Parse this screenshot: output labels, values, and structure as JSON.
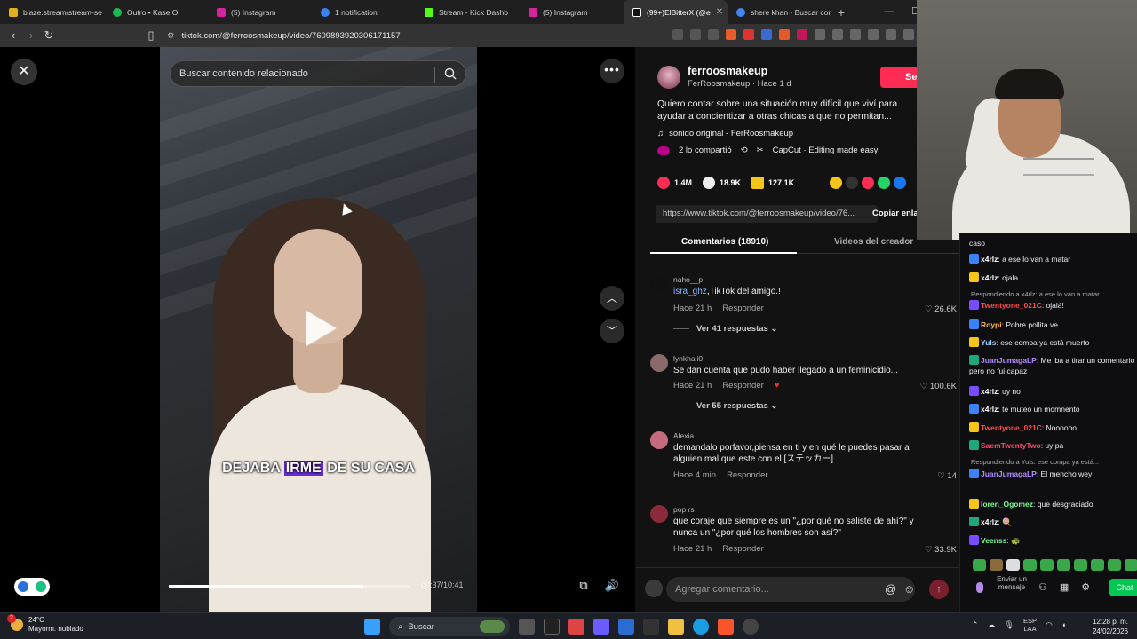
{
  "browser": {
    "tabs": [
      {
        "label": "blaze.stream/stream-se",
        "color": "#e0b020"
      },
      {
        "label": "Outro • Kase.O",
        "color": "#1db954"
      },
      {
        "label": "(5) Instagram",
        "color": "#d6249f"
      },
      {
        "label": "1 notification",
        "color": "#3b82f6"
      },
      {
        "label": "Stream - Kick Dashb",
        "color": "#53fc18"
      },
      {
        "label": "(5) Instagram",
        "color": "#d6249f"
      },
      {
        "label": "(99+)ElBitterX (@e",
        "color": "#ffffff"
      },
      {
        "label": "shere khan - Buscar con",
        "color": "#4285f4"
      }
    ],
    "new_tab": "+",
    "url": "tiktok.com/@ferroosmakeup/video/7609893920306171157"
  },
  "video": {
    "search_placeholder": "Buscar contenido relacionado",
    "caption_before": "DEJABA ",
    "caption_highlight": "IRME",
    "caption_after": " DE SU CASA",
    "time": "00:37/10:41",
    "progress": 0.805
  },
  "post": {
    "username": "ferroosmakeup",
    "subline": "FerRoosmakeup · Hace 1 d",
    "follow": "Seguir",
    "description": "Quiero contar sobre una situación muy difícil que viví para ayudar a concientizar a otras chicas a que no permitan...",
    "sound": "sonido original - FerRoosmakeup",
    "shared": "2 lo compartió",
    "capcut": "CapCut · Editing made easy",
    "likes": "1.4M",
    "comments": "18.9K",
    "saves": "127.1K",
    "link": "https://www.tiktok.com/@ferroosmakeup/video/76...",
    "copy_link": "Copiar enlace",
    "tab_comments": "Comentarios (18910)",
    "tab_videos": "Videos del creador"
  },
  "comments": [
    {
      "user": "naho__p",
      "mention": "isra_ghz",
      "text": ",TikTok del amigo.!",
      "time": "Hace 21 h",
      "reply": "Responder",
      "likes": "26.6K",
      "replies": "Ver 41 respuestas",
      "avatar_color": "#111111"
    },
    {
      "user": "lynkhali0",
      "mention": "",
      "text": "Se dan cuenta que pudo haber llegado a un feminicidio...",
      "time": "Hace 21 h",
      "reply": "Responder",
      "likes": "100.6K",
      "replies": "Ver 55 respuestas",
      "avatar_color": "#8a6a6a"
    },
    {
      "user": "Alexia",
      "mention": "",
      "text": "demandalo porfavor,piensa en ti y en qué le puedes pasar a alguien mal que este con el [ステッカー]",
      "time": "Hace 4 min",
      "reply": "Responder",
      "likes": "14",
      "replies": "",
      "avatar_color": "#c66b7d"
    },
    {
      "user": "pop ɾs",
      "mention": "",
      "text": "que coraje que siempre es un \"¿por qué no saliste de ahí?\" y nunca un \"¿por qué los hombres son así?\"",
      "time": "Hace 21 h",
      "reply": "Responder",
      "likes": "33.9K",
      "replies": "",
      "avatar_color": "#8a2a3a"
    }
  ],
  "add_comment_placeholder": "Agregar comentario...",
  "chat": {
    "top_fragment": "caso",
    "lines": [
      {
        "name": "x4rlz",
        "color": "#ffffff",
        "msg": ": a ese lo van a matar"
      },
      {
        "name": "x4rlz",
        "color": "#ffffff",
        "msg": ": ojala"
      },
      {
        "reply": "Respondiendo a x4rlz: a ese lo van a matar"
      },
      {
        "name": "Twentyone_021C",
        "color": "#ff4d4d",
        "msg": ": ojalá!"
      },
      {
        "name": "Roypi",
        "color": "#ffb84d",
        "msg": ": Pobre pollita ve"
      },
      {
        "name": "Yuls",
        "color": "#9ad0ff",
        "msg": ": ese compa ya está muerto"
      },
      {
        "name": "JuanJumagaLP",
        "color": "#b38cff",
        "msg": ": Me iba a tirar un comentario pero no fui capaz"
      },
      {
        "name": "x4rlz",
        "color": "#ffffff",
        "msg": ": uy no"
      },
      {
        "name": "x4rlz",
        "color": "#ffffff",
        "msg": ": te muteo un momnento"
      },
      {
        "name": "Twentyone_021C",
        "color": "#ff4d4d",
        "msg": ": Noooooo"
      },
      {
        "name": "SaemTwentyTwo",
        "color": "#ff4d6a",
        "msg": ": uy pa"
      },
      {
        "reply": "Respondiendo a Yuls: ese compa ya está..."
      },
      {
        "name": "JuanJumagaLP",
        "color": "#b38cff",
        "msg": ": El mencho wey"
      },
      {
        "name": "loren_Ogomez",
        "color": "#7dff9a",
        "msg": ": que desgraciado"
      },
      {
        "name": "x4rlz",
        "color": "#ffffff",
        "msg": ": 🍭"
      },
      {
        "name": "Veenss",
        "color": "#7dff9a",
        "msg": ": 🐢"
      }
    ],
    "send_label": "Enviar un mensaje",
    "chat_button": "Chat"
  },
  "taskbar": {
    "weather_temp": "24°C",
    "weather_desc": "Mayorm. nublado",
    "weather_badge": "2",
    "search": "Buscar",
    "lang_top": "ESP",
    "lang_bottom": "LAA",
    "time": "12:28 p. m.",
    "date": "24/02/2026"
  }
}
